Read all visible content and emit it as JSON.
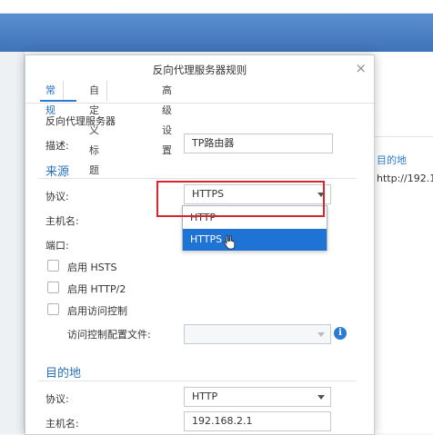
{
  "dialog": {
    "title": "反向代理服务器规则",
    "close_icon": "×",
    "tabs": [
      "常规",
      "自定义标题",
      "高级设置"
    ],
    "active_tab": "常规",
    "subtitle": "反向代理服务器",
    "description_label": "描述:",
    "description_value": "TP路由器"
  },
  "source": {
    "title": "来源",
    "protocol_label": "协议:",
    "protocol_value": "HTTPS",
    "hostname_label": "主机名:",
    "port_label": "端口:",
    "enable_hsts": "启用 HSTS",
    "enable_http2": "启用 HTTP/2",
    "enable_access_control": "启用访问控制",
    "access_profile_label": "访问控制配置文件:",
    "dropdown_options": [
      "HTTP",
      "HTTPS"
    ],
    "dropdown_selected": "HTTPS"
  },
  "destination": {
    "title": "目的地",
    "protocol_label": "协议:",
    "protocol_value": "HTTP",
    "hostname_label": "主机名:",
    "hostname_value": "192.168.2.1"
  },
  "background": {
    "right_text_1": "目的地",
    "right_text_2": "http://192.1"
  },
  "icons": {
    "info": "i",
    "close": "close-icon",
    "cursor": "hand-cursor-icon"
  },
  "colors": {
    "accent": "#2a70c0",
    "selected": "#1e73d4",
    "highlight_box": "#d8262c"
  }
}
